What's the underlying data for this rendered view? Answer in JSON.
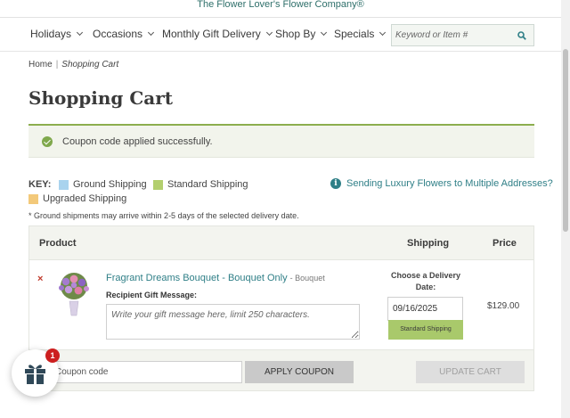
{
  "header": {
    "tagline": "The Flower Lover's Flower Company®"
  },
  "nav": {
    "items": [
      {
        "label": "Holidays"
      },
      {
        "label": "Occasions"
      },
      {
        "label": "Monthly Gift Delivery"
      },
      {
        "label": "Shop By"
      },
      {
        "label": "Specials"
      }
    ],
    "search_placeholder": "Keyword or Item #",
    "search_icon": "search-icon"
  },
  "breadcrumb": {
    "home": "Home",
    "separator": "|",
    "current": "Shopping Cart"
  },
  "page": {
    "title": "Shopping Cart"
  },
  "notice": {
    "text": "Coupon code applied successfully.",
    "icon": "check-circle-icon"
  },
  "key": {
    "label": "KEY:",
    "items": [
      {
        "label": "Ground Shipping",
        "color": "#a9d3ee"
      },
      {
        "label": "Standard Shipping",
        "color": "#b3cf6e"
      },
      {
        "label": "Upgraded Shipping",
        "color": "#f3c97a"
      }
    ],
    "luxury_link": "Sending Luxury Flowers to Multiple Addresses?",
    "note": "* Ground shipments may arrive within 2-5 days of the selected delivery date."
  },
  "table": {
    "headers": {
      "product": "Product",
      "shipping": "Shipping",
      "price": "Price"
    },
    "rows": [
      {
        "remove": "×",
        "name": "Fragrant Dreams Bouquet - Bouquet Only",
        "type": "- Bouquet",
        "gift_label": "Recipient Gift Message:",
        "gift_placeholder": "Write your gift message here, limit 250 characters.",
        "delivery_label": "Choose a Delivery Date:",
        "delivery_date": "09/16/2025",
        "shipping_method": "Standard Shipping",
        "price": "$129.00"
      }
    ]
  },
  "footer": {
    "coupon_placeholder": "Coupon code",
    "apply_label": "APPLY COUPON",
    "update_label": "UPDATE CART"
  },
  "gift_widget": {
    "badge_count": "1",
    "icon": "gift-icon"
  },
  "colors": {
    "accent_teal": "#2f7f87",
    "accent_green": "#8cae4e"
  }
}
